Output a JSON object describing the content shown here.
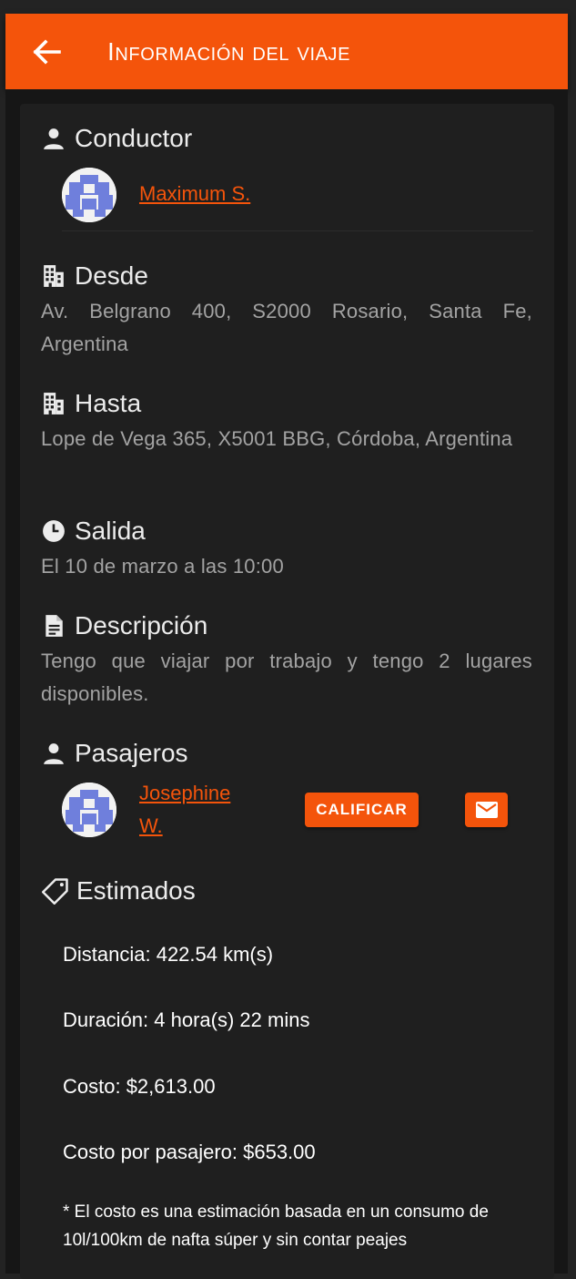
{
  "toolbar": {
    "back_icon": "arrow-left-icon",
    "title": "Información del viaje",
    "color": "#f4540b"
  },
  "conductor": {
    "heading": "Conductor",
    "icon": "person-icon",
    "name": "Maximum S."
  },
  "desde": {
    "heading": "Desde",
    "icon": "building-icon",
    "address": "Av. Belgrano 400, S2000 Rosario, Santa Fe, Argentina"
  },
  "hasta": {
    "heading": "Hasta",
    "icon": "building-icon",
    "address": "Lope de Vega 365, X5001 BBG, Córdoba, Argentina"
  },
  "salida": {
    "heading": "Salida",
    "icon": "clock-icon",
    "value": "El 10 de marzo a las 10:00"
  },
  "descripcion": {
    "heading": "Descripción",
    "icon": "document-icon",
    "value": "Tengo que viajar por trabajo y tengo 2 lugares disponibles."
  },
  "pasajeros": {
    "heading": "Pasajeros",
    "icon": "person-icon",
    "items": [
      {
        "name_line1": "Josephine",
        "name_line2": "W.",
        "rate_label": "CALIFICAR",
        "mail_icon": "mail-icon"
      }
    ]
  },
  "estimados": {
    "heading": "Estimados",
    "icon": "tag-icon",
    "distancia": "Distancia: 422.54 km(s)",
    "duracion": "Duración: 4 hora(s) 22 mins",
    "costo": "Costo: $2,613.00",
    "costo_pasajero": "Costo por pasajero: $653.00",
    "note": "* El costo es una estimación basada en un consumo de 10l/100km de nafta súper y sin contar peajes"
  }
}
